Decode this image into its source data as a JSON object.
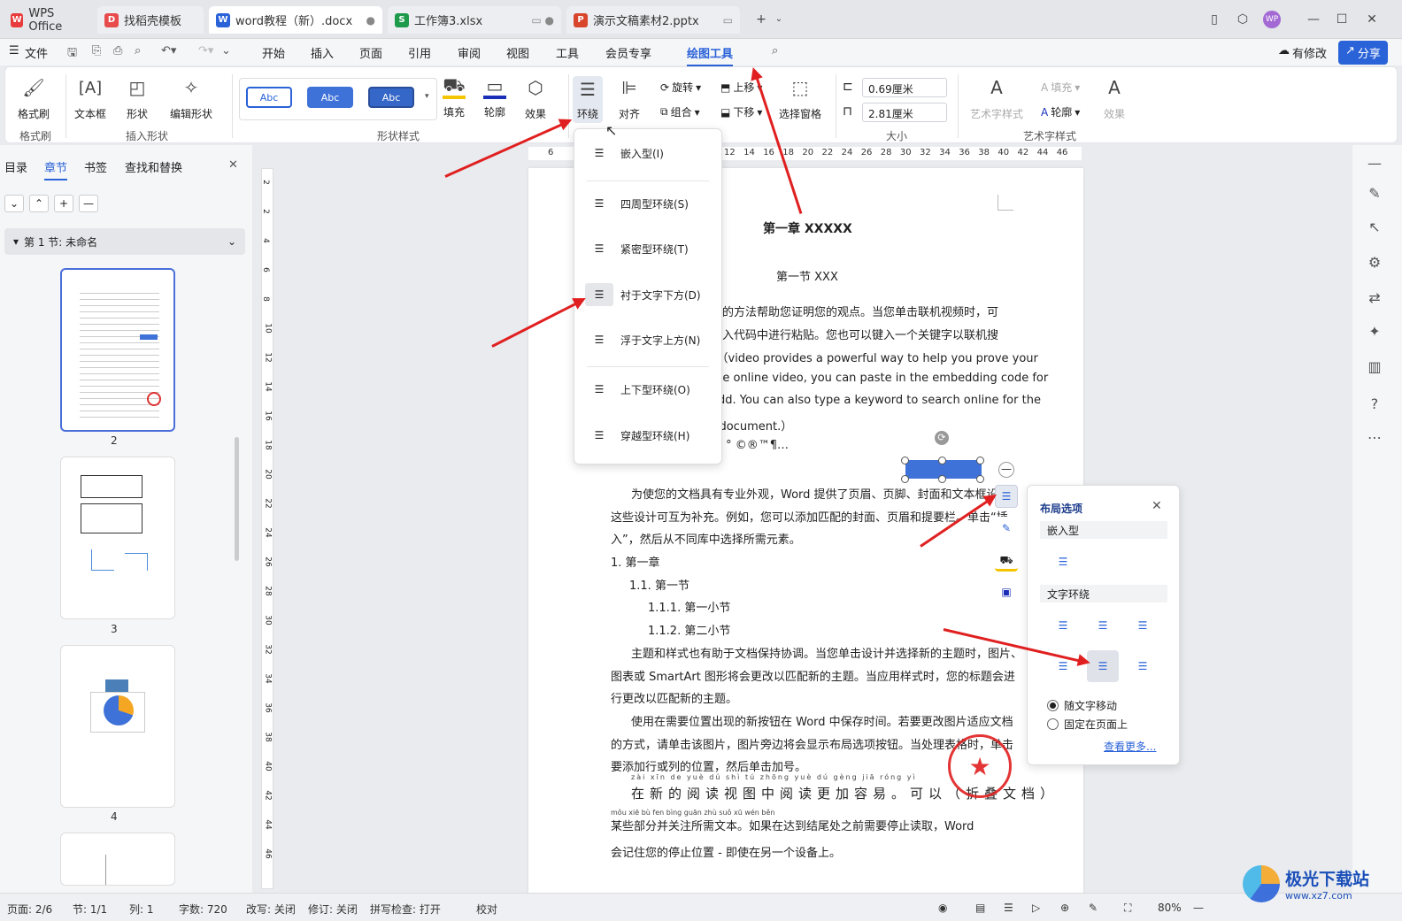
{
  "tabs": [
    {
      "label": "WPS Office",
      "icon": "wps-icon"
    },
    {
      "label": "找稻壳模板",
      "icon": "docer-icon"
    },
    {
      "label": "word教程（新）.docx",
      "icon": "word-doc-icon"
    },
    {
      "label": "工作簿3.xlsx",
      "icon": "sheet-icon"
    },
    {
      "label": "演示文稿素材2.pptx",
      "icon": "ppt-icon"
    }
  ],
  "menu": {
    "file": "文件",
    "items": [
      "开始",
      "插入",
      "页面",
      "引用",
      "审阅",
      "视图",
      "工具",
      "会员专享",
      "绘图工具"
    ],
    "active": "绘图工具",
    "modified": "有修改",
    "share": "分享"
  },
  "ribbon": {
    "format_painter": "格式刷",
    "text_box": "文本框",
    "shape": "形状",
    "edit_shape": "编辑形状",
    "style_samples": [
      "Abc",
      "Abc",
      "Abc"
    ],
    "fill": "填充",
    "outline": "轮廓",
    "effect": "效果",
    "wrap": "环绕",
    "align": "对齐",
    "rotate": "旋转",
    "group": "组合",
    "move_up": "上移",
    "move_down": "下移",
    "selection_pane": "选择窗格",
    "height": "0.69厘米",
    "width": "2.81厘米",
    "art_style": "艺术字样式",
    "art_fill": "填充",
    "art_outline": "轮廓",
    "art_effect": "效果",
    "groups": {
      "format_painter": "格式刷",
      "insert_shape": "插入形状",
      "shape_style": "形状样式",
      "size": "大小",
      "art_style": "艺术字样式"
    }
  },
  "wrap_menu": [
    "嵌入型(I)",
    "四周型环绕(S)",
    "紧密型环绕(T)",
    "衬于文字下方(D)",
    "浮于文字上方(N)",
    "上下型环绕(O)",
    "穿越型环绕(H)"
  ],
  "left_panel": {
    "tabs": [
      "目录",
      "章节",
      "书签",
      "查找和替换"
    ],
    "active": "章节",
    "section": "第 1 节: 未命名",
    "pages": [
      "2",
      "3",
      "4"
    ]
  },
  "hruler": [
    "6",
    "12",
    "14",
    "16",
    "18",
    "20",
    "22",
    "24",
    "26",
    "28",
    "30",
    "32",
    "34",
    "36",
    "38",
    "40",
    "42",
    "44",
    "46"
  ],
  "vruler": [
    "2",
    "2",
    "4",
    "6",
    "8",
    "10",
    "12",
    "14",
    "16",
    "18",
    "20",
    "22",
    "24",
    "26",
    "28",
    "30",
    "32",
    "34",
    "36",
    "38",
    "40",
    "42",
    "44",
    "46"
  ],
  "document": {
    "chapter": "第一章  XXXXX",
    "section": "第一节 XXX",
    "p1": [
      "大的方法帮助您证明您的观点。当您单击联机视频时，可",
      "嵌入代码中进行粘贴。您也可以键入一个关键字以联机搜",
      "。（video provides a powerful way to help you prove your",
      "the online video, you can paste in the embedding code for",
      "add. You can also type a keyword to search online for the",
      "r document.）"
    ],
    "symbols": "—     °  ©®™¶…",
    "p2": [
      "为使您的文档具有专业外观，Word 提供了页眉、页脚、封面和文本框设计",
      "这些设计可互为补充。例如，您可以添加匹配的封面、页眉和提要栏。单击“插",
      "入”，然后从不同库中选择所需元素。"
    ],
    "list": [
      "1.   第一章",
      "1.1.  第一节",
      "1.1.1.   第一小节",
      "1.1.2.   第二小节"
    ],
    "p3": [
      "主题和样式也有助于文档保持协调。当您单击设计并选择新的主题时，图片、",
      "图表或 SmartArt 图形将会更改以匹配新的主题。当应用样式时，您的标题会进",
      "行更改以匹配新的主题。"
    ],
    "p4": [
      "使用在需要位置出现的新按钮在 Word 中保存时间。若要更改图片适应文档",
      "的方式，请单击该图片，图片旁边将会显示布局选项按钮。当处理表格时，单击",
      "要添加行或列的位置，然后单击加号。"
    ],
    "p5": [
      "在新的阅读视图中阅读更加容易。可以（折叠文档）",
      "某些部分并关注所需文本。如果在达到结尾处之前需要停止读取，Word",
      "会记住您的停止位置 - 即使在另一个设备上。"
    ],
    "ruby": [
      "zài xīn de yuè dú shì tú zhōng yuè dú gèng jiā róng yì",
      "mǒu xiē bù fen bìng guān zhù suǒ xū wén běn"
    ]
  },
  "layout_panel": {
    "title": "布局选项",
    "inline": "嵌入型",
    "wrap": "文字环绕",
    "move_with_text": "随文字移动",
    "fix_on_page": "固定在页面上",
    "more": "查看更多..."
  },
  "status": {
    "page": "页面: 2/6",
    "section": "节: 1/1",
    "col": "列: 1",
    "words": "字数: 720",
    "rewrite": "改写: 关闭",
    "revision": "修订: 关闭",
    "spell": "拼写检查: 打开",
    "proof": "校对",
    "zoom": "80%"
  },
  "watermark": {
    "site": "极光下载站",
    "url": "www.xz7.com"
  },
  "colors": {
    "accent": "#2a62d8",
    "arrow": "#e02020"
  }
}
